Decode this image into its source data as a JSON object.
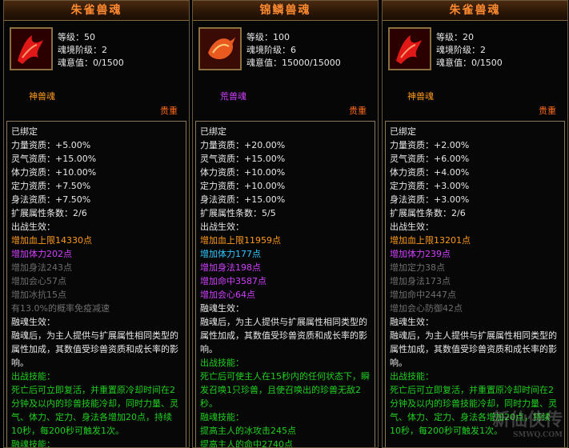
{
  "colors": {
    "accent": "#ff8a30",
    "purple": "#d040ff",
    "cyan": "#30c8ff",
    "gray": "#6e6e6e",
    "green": "#20d020",
    "gold": "#ff9a1a"
  },
  "panels": [
    {
      "title": "朱雀兽魂",
      "icon": "vermilion-bird-soul-icon",
      "level": "等级：50",
      "tier": "魂境阶级：2",
      "soul": "魂意值：0/1500",
      "rank": "神兽魂",
      "rank_color": "#ff9a1a",
      "grade": "贵重",
      "bound": "已绑定",
      "stats": [
        "力量资质：+5.00%",
        "灵气资质：+15.00%",
        "体力资质：+10.00%",
        "定力资质：+7.50%",
        "身法资质：+7.50%"
      ],
      "ext": "扩展属性条数：2/6",
      "battle_header": "出战生效：",
      "effects": [
        {
          "text": "增加血上限14330点",
          "color": "gold"
        },
        {
          "text": "增加体力202点",
          "color": "purple"
        },
        {
          "text": "增加身法243点",
          "color": "gray"
        },
        {
          "text": "增加会心57点",
          "color": "gray"
        },
        {
          "text": "增加冰抗15点",
          "color": "gray"
        },
        {
          "text": "有13.0%的概率免疫减速",
          "color": "gray"
        }
      ],
      "fuse_header": "融魂生效：",
      "fuse_desc": "融魂后，为主人提供与扩展属性相同类型的属性加成，其数值受珍兽资质和成长率的影响。",
      "skill_header": "出战技能：",
      "skill_desc": "死亡后可立即复活，并重置原冷却时间在2分钟及以内的珍兽技能冷却，同时力量、灵气、体力、定力、身法各增加20点，持续10秒，每200秒可触发1次。",
      "fuse_skill_header": "融魂技能："
    },
    {
      "title": "锦鳞兽魂",
      "icon": "brocade-scale-soul-icon",
      "level": "等级：100",
      "tier": "魂境阶级：6",
      "soul": "魂意值：15000/15000",
      "rank": "荒兽魂",
      "rank_color": "#d040ff",
      "grade": "贵重",
      "bound": "已绑定",
      "stats": [
        "力量资质：+20.00%",
        "灵气资质：+15.00%",
        "体力资质：+10.00%",
        "定力资质：+10.00%",
        "身法资质：+15.00%"
      ],
      "ext": "扩展属性条数：5/5",
      "battle_header": "出战生效：",
      "effects": [
        {
          "text": "增加血上限11959点",
          "color": "gold"
        },
        {
          "text": "增加体力177点",
          "color": "cyan"
        },
        {
          "text": "增加身法198点",
          "color": "purple"
        },
        {
          "text": "增加命中3587点",
          "color": "purple"
        },
        {
          "text": "增加会心64点",
          "color": "purple"
        }
      ],
      "fuse_header": "融魂生效：",
      "fuse_desc": "融魂后，为主人提供与扩展属性相同类型的属性加成，其数值受珍兽资质和成长率的影响。",
      "skill_header": "出战技能：",
      "skill_desc": "死亡后可使主人在15秒内的任何状态下，瞬发召唤1只珍兽，且使召唤出的珍兽无敌2秒。",
      "fuse_skill_header": "融魂技能：",
      "fuse_skills": [
        "提高主人的冰攻击245点",
        "提高主人的命中2740点"
      ]
    },
    {
      "title": "朱雀兽魂",
      "icon": "vermilion-bird-soul-icon",
      "level": "等级：20",
      "tier": "魂境阶级：2",
      "soul": "魂意值：0/1500",
      "rank": "神兽魂",
      "rank_color": "#ff9a1a",
      "grade": "贵重",
      "bound": "已绑定",
      "stats": [
        "力量资质：+2.00%",
        "灵气资质：+6.00%",
        "体力资质：+4.00%",
        "定力资质：+3.00%",
        "身法资质：+3.00%"
      ],
      "ext": "扩展属性条数：2/6",
      "battle_header": "出战生效：",
      "effects": [
        {
          "text": "增加血上限13201点",
          "color": "gold"
        },
        {
          "text": "增加体力239点",
          "color": "purple"
        },
        {
          "text": "增加定力38点",
          "color": "gray"
        },
        {
          "text": "增加身法173点",
          "color": "gray"
        },
        {
          "text": "增加命中2447点",
          "color": "gray"
        },
        {
          "text": "增加会心防御42点",
          "color": "gray"
        }
      ],
      "fuse_header": "融魂生效：",
      "fuse_desc": "融魂后，为主人提供与扩展属性相同类型的属性加成，其数值受珍兽资质和成长率的影响。",
      "skill_header": "出战技能：",
      "skill_desc": "死亡后可立即复活，并重置原冷却时间在2分钟及以内的珍兽技能冷却，同时力量、灵气、体力、定力、身法各增加20点，持续10秒，每200秒可触发1次。",
      "watermark": "新仙侠传",
      "watermark_sub": "SMWQ.COM"
    }
  ]
}
